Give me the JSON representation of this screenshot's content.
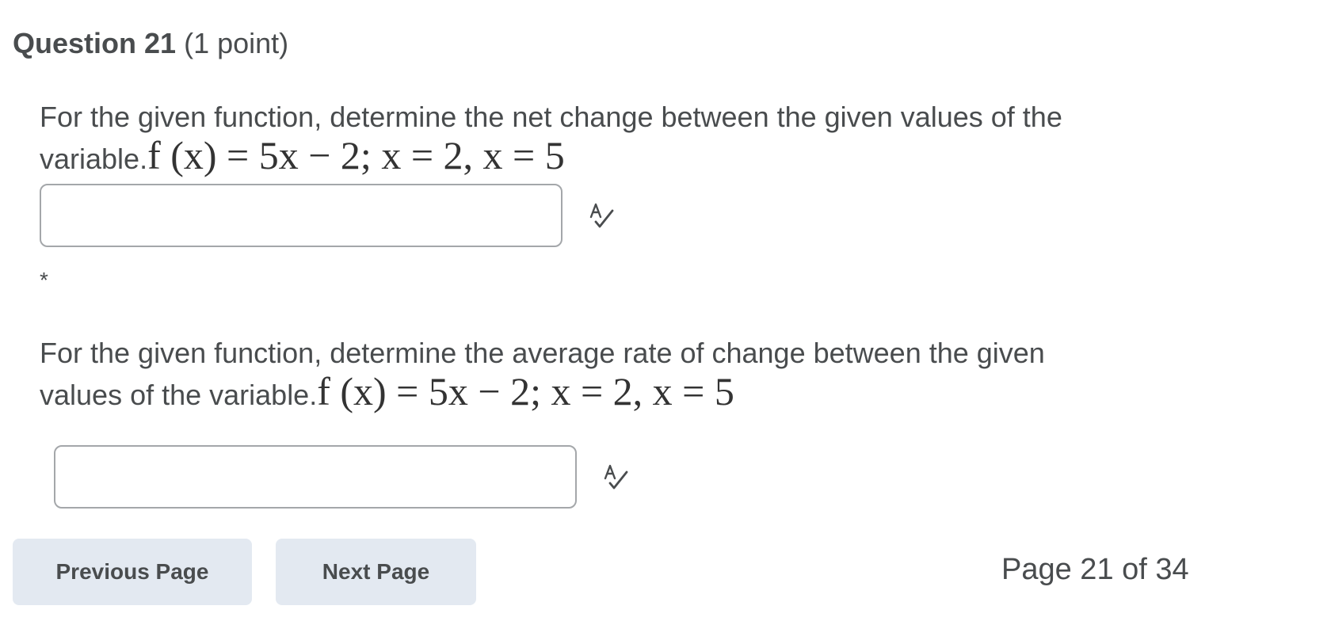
{
  "question": {
    "title": "Question 21",
    "points": "(1 point)"
  },
  "parts": [
    {
      "prompt_text": "For the given function, determine the net change between the given values of the",
      "prompt_text_2": "variable.",
      "math": "f (x)  =  5x − 2;  x  =  2,  x  =  5",
      "answer_value": "",
      "spell_icon": "spell-check-icon"
    },
    {
      "prompt_text": "For the given function, determine the average rate of change between the given",
      "prompt_text_2": "values of the variable.",
      "math": "f (x)  =  5x − 2;  x  =  2,  x  =  5",
      "answer_value": "",
      "spell_icon": "spell-check-icon"
    }
  ],
  "asterisk": "*",
  "navigation": {
    "previous_label": "Previous Page",
    "next_label": "Next Page",
    "page_indicator": "Page 21 of 34"
  },
  "colors": {
    "text": "#494c4e",
    "button_bg": "#e3e9f1",
    "input_border": "#a4a7aa"
  }
}
